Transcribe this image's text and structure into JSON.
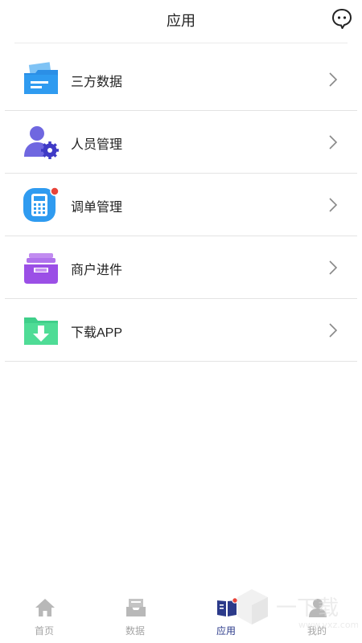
{
  "header": {
    "title": "应用"
  },
  "menu": {
    "items": [
      {
        "label": "三方数据",
        "icon": "document-folder-icon"
      },
      {
        "label": "人员管理",
        "icon": "user-settings-icon"
      },
      {
        "label": "调单管理",
        "icon": "calculator-icon",
        "has_badge": true
      },
      {
        "label": "商户进件",
        "icon": "inbox-tray-icon"
      },
      {
        "label": "下载APP",
        "icon": "download-folder-icon"
      }
    ]
  },
  "tabbar": {
    "tabs": [
      {
        "label": "首页",
        "icon": "home-icon"
      },
      {
        "label": "数据",
        "icon": "inbox-icon"
      },
      {
        "label": "应用",
        "icon": "book-icon",
        "active": true
      },
      {
        "label": "我的",
        "icon": "person-icon"
      }
    ]
  },
  "colors": {
    "accent": "#2b3a8a",
    "badge": "#e8443a",
    "inactive": "#a5a5a5"
  }
}
